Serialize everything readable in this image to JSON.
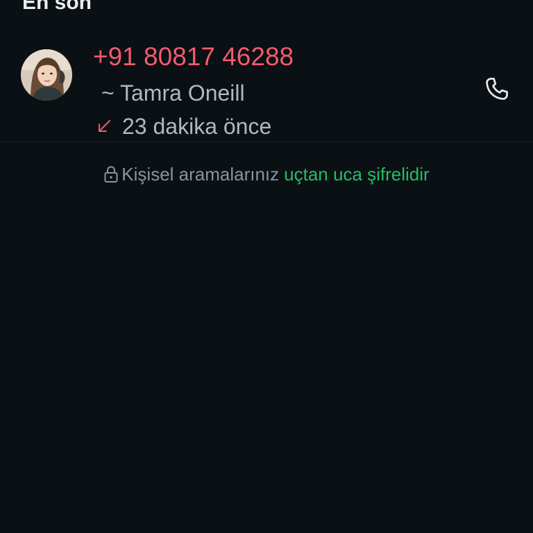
{
  "section": {
    "title": "En son"
  },
  "call": {
    "number": "+91 80817 46288",
    "name": "~ Tamra Oneill",
    "time": "23 dakika önce",
    "type_icon": "missed-incoming-arrow-icon",
    "action_icon": "phone-icon"
  },
  "footer": {
    "text": "Kişisel aramalarınız",
    "link": "uçtan uca şifrelidir",
    "icon": "lock-icon"
  },
  "colors": {
    "background": "#0b1014",
    "missed_call": "#f15c6d",
    "secondary_text": "#aebac1",
    "link": "#21c063"
  }
}
